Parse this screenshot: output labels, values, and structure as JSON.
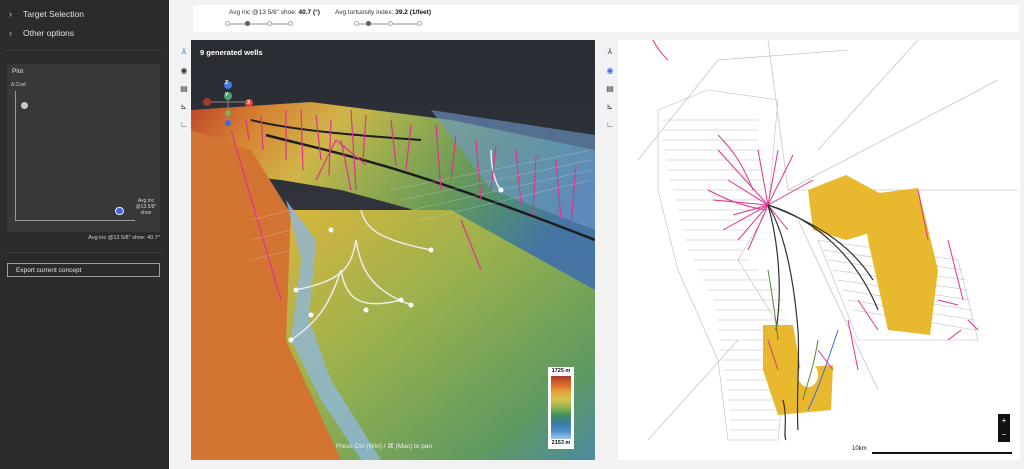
{
  "sidebar": {
    "sections": [
      {
        "label": "Target Selection",
        "icon": "chevron-right-icon"
      },
      {
        "label": "Other options",
        "icon": "chevron-right-icon"
      }
    ],
    "plot": {
      "title": "Plot",
      "y_label": "Δ Cost",
      "x_label": "Avg inc @13 5/8\" shoe",
      "caption": "Avg inc @13 5/8\" shoe: 40.7°",
      "points": [
        {
          "state": "inactive",
          "color": "#c9c9c9"
        },
        {
          "state": "selected",
          "color": "#3f6ae0"
        }
      ]
    },
    "export_button": "Export current concept"
  },
  "controls": {
    "inclination": {
      "label": "Avg inc @13 5/8\" shoe:",
      "value": "40.7 (°)",
      "stops": 4,
      "selected_stop": 2
    },
    "tortuosity": {
      "label": "Avg tortuosity index:",
      "value": "39.2 (1/feet)",
      "stops": 4,
      "selected_stop": 1
    }
  },
  "view3d": {
    "title": "9 generated wells",
    "pan_hint": "Press Ctrl (Win) / ⌘ (Mac) to pan",
    "legend": {
      "max": "1725 m",
      "min": "2153 m"
    },
    "axis_markers": [
      "Z",
      "Y",
      "X"
    ]
  },
  "view_toolbar": {
    "icons": [
      "well-network-icon",
      "globe-icon",
      "layers-icon",
      "crossplot-icon",
      "plot-icon"
    ]
  },
  "view2d": {
    "scale_label": "10km",
    "zoom_in": "+",
    "zoom_out": "−"
  },
  "colors": {
    "sidebar_bg": "#2b2b2b",
    "well_existing": "#e0338f",
    "well_generated": "#ffffff",
    "target_zone": "#e8b92e",
    "accent": "#3f6ae0"
  }
}
